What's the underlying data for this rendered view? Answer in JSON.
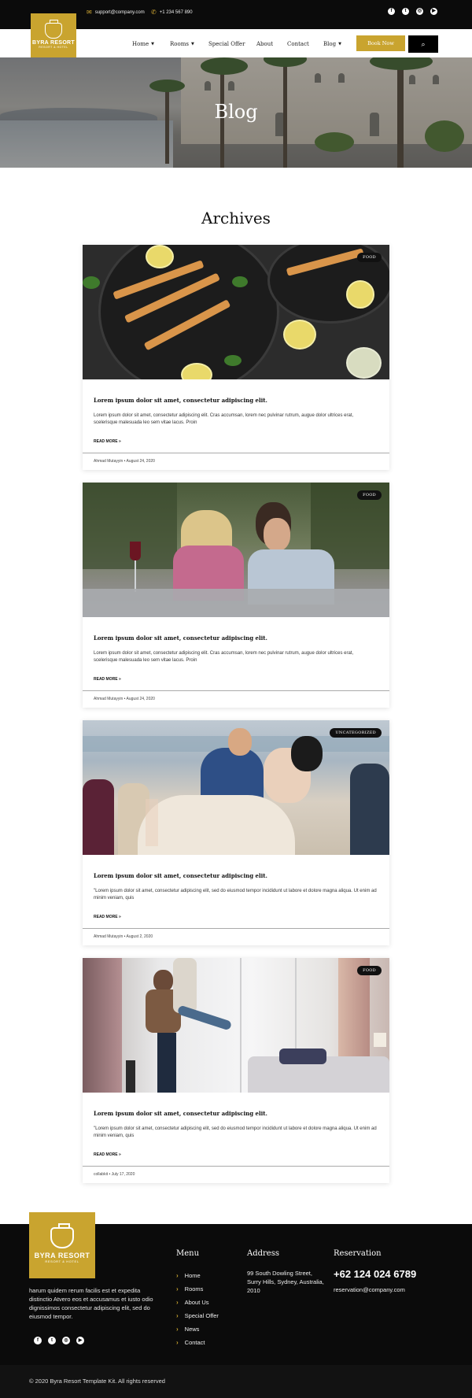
{
  "topbar": {
    "email": "support@company.com",
    "phone": "+1 234 567 890",
    "social": [
      {
        "icon": "facebook-icon",
        "glyph": "f"
      },
      {
        "icon": "twitter-icon",
        "glyph": "t"
      },
      {
        "icon": "instagram-icon",
        "glyph": "◎"
      },
      {
        "icon": "youtube-icon",
        "glyph": "▶"
      }
    ]
  },
  "brand": {
    "name": "BYRA RESORT",
    "tagline": "RESORT & HOTEL",
    "color": "#c9a42f"
  },
  "nav": {
    "items": [
      {
        "label": "Home",
        "caret": true
      },
      {
        "label": "Rooms",
        "caret": true
      },
      {
        "label": "Special Offer",
        "caret": false
      },
      {
        "label": "About",
        "caret": false
      },
      {
        "label": "Contact",
        "caret": false
      },
      {
        "label": "Blog",
        "caret": true
      }
    ],
    "book_label": "Book Now",
    "search_icon": "search-icon"
  },
  "hero": {
    "title": "Blog"
  },
  "archives": {
    "title": "Archives",
    "posts": [
      {
        "badge": "FOOD",
        "title": "Lorem ipsum dolor sit amet, consectetur adipiscing elit.",
        "excerpt": "Lorem ipsum dolor sit amet, consectetur adipiscing elit. Cras accumsan, lorem nec pulvinar rutrum, augue dolor ultrices erat, scelerisque malesuada leo sem vitae lacus. Proin",
        "read_more": "READ MORE »",
        "author": "Ahmad Mutayyin",
        "date": "August 24, 2020"
      },
      {
        "badge": "FOOD",
        "title": "Lorem ipsum dolor sit amet, consectetur adipiscing elit.",
        "excerpt": "Lorem ipsum dolor sit amet, consectetur adipiscing elit. Cras accumsan, lorem nec pulvinar rutrum, augue dolor ultrices erat, scelerisque malesuada leo sem vitae lacus. Proin",
        "read_more": "READ MORE »",
        "author": "Ahmad Mutayyin",
        "date": "August 24, 2020"
      },
      {
        "badge": "UNCATEGORIZED",
        "title": "Lorem ipsum dolor sit amet, consectetur adipiscing elit.",
        "excerpt": "\"Lorem ipsum dolor sit amet, consectetur adipiscing elit, sed do eiusmod tempor incididunt ut labore et dolore magna aliqua. Ut enim ad minim veniam, quis",
        "read_more": "READ MORE »",
        "author": "Ahmad Mutayyin",
        "date": "August 2, 2020"
      },
      {
        "badge": "FOOD",
        "title": "Lorem ipsum dolor sit amet, consectetur adipiscing elit.",
        "excerpt": "\"Lorem ipsum dolor sit amet, consectetur adipiscing elit, sed do eiusmod tempor incididunt ut labore et dolore magna aliqua. Ut enim ad minim veniam, quis",
        "read_more": "READ MORE »",
        "author": "collabkit",
        "date": "July 17, 2020"
      }
    ]
  },
  "footer": {
    "about": "harum quidem rerum facilis est et expedita distinctio Atvero eos et accusamus et iusto odio dignissimos consectetur adipiscing elit, sed do eiusmod tempor.",
    "menu_title": "Menu",
    "menu": [
      "Home",
      "Rooms",
      "About Us",
      "Special Offer",
      "News",
      "Contact"
    ],
    "address_title": "Address",
    "address": "99 South Dowling Street, Surry Hills, Sydney, Australia, 2010",
    "reservation_title": "Reservation",
    "phone": "+62 124 024 6789",
    "email": "reservation@company.com",
    "copyright": "© 2020 Byra Resort Template Kit. All rights reserved"
  }
}
